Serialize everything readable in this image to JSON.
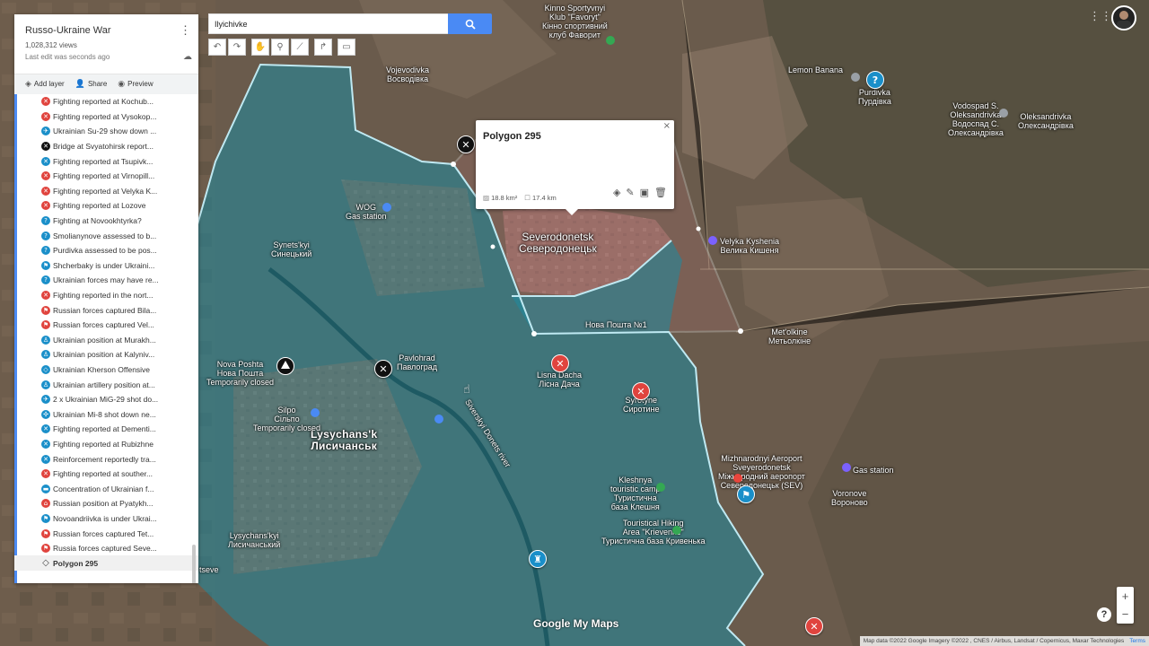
{
  "map": {
    "title": "Russo-Ukraine War",
    "views": "1,028,312 views",
    "last_edit": "Last edit was seconds ago",
    "actions": {
      "add_layer": "Add layer",
      "share": "Share",
      "preview": "Preview"
    },
    "search_value": "Ilyichivke",
    "colors": {
      "occupied": "#1e8aa0",
      "accent": "#4a8af4",
      "red_marker": "#e0443e"
    }
  },
  "layer_items": [
    {
      "label": "Fighting reported at Kochub...",
      "icon": "red-crossed-swords-icon",
      "color": "#e0443e"
    },
    {
      "label": "Fighting reported at Vysokop...",
      "icon": "red-crossed-swords-icon",
      "color": "#e0443e"
    },
    {
      "label": "Ukrainian Su-29 show down ...",
      "icon": "blue-plane-icon",
      "color": "#1a8fc9"
    },
    {
      "label": "Bridge at Svyatohirsk report...",
      "icon": "black-x-icon",
      "color": "#111111"
    },
    {
      "label": "Fighting reported at Tsupivk...",
      "icon": "blue-crossed-swords-icon",
      "color": "#1a8fc9"
    },
    {
      "label": "Fighting reported at Virnopill...",
      "icon": "red-crossed-swords-icon",
      "color": "#e0443e"
    },
    {
      "label": "Fighting reported at Velyka K...",
      "icon": "red-crossed-swords-icon",
      "color": "#e0443e"
    },
    {
      "label": "Fighting reported at Lozove",
      "icon": "red-crossed-swords-icon",
      "color": "#e0443e"
    },
    {
      "label": "Fighting at Novookhtyrka?",
      "icon": "blue-question-icon",
      "color": "#1a8fc9"
    },
    {
      "label": "Smolianynove assessed to b...",
      "icon": "blue-question-icon",
      "color": "#1a8fc9"
    },
    {
      "label": "Purdivka assessed to be pos...",
      "icon": "blue-question-icon",
      "color": "#1a8fc9"
    },
    {
      "label": "Shcherbaky is under Ukraini...",
      "icon": "blue-flag-icon",
      "color": "#1a8fc9"
    },
    {
      "label": "Ukrainian forces may have re...",
      "icon": "blue-question-icon",
      "color": "#1a8fc9"
    },
    {
      "label": "Fighting reported in the nort...",
      "icon": "red-crossed-swords-icon",
      "color": "#e0443e"
    },
    {
      "label": "Russian forces captured Bila...",
      "icon": "red-flag-icon",
      "color": "#e0443e"
    },
    {
      "label": "Russian forces captured Vel...",
      "icon": "red-flag-icon",
      "color": "#e0443e"
    },
    {
      "label": "Ukrainian position at Murakh...",
      "icon": "blue-soldier-icon",
      "color": "#1a8fc9"
    },
    {
      "label": "Ukrainian position at Kalyniv...",
      "icon": "blue-soldier-icon",
      "color": "#1a8fc9"
    },
    {
      "label": "Ukrainian Kherson Offensive",
      "icon": "blue-polygon-icon",
      "color": "#1a8fc9"
    },
    {
      "label": "Ukrainian artillery position at...",
      "icon": "blue-soldier-icon",
      "color": "#1a8fc9"
    },
    {
      "label": "2 x Ukrainian MiG-29 shot do...",
      "icon": "blue-plane-icon",
      "color": "#1a8fc9"
    },
    {
      "label": "Ukrainian Mi-8 shot down ne...",
      "icon": "blue-helicopter-icon",
      "color": "#1a8fc9"
    },
    {
      "label": "Fighting reported at Dementi...",
      "icon": "blue-crossed-swords-icon",
      "color": "#1a8fc9"
    },
    {
      "label": "Fighting reported at Rubizhne",
      "icon": "blue-crossed-swords-icon",
      "color": "#1a8fc9"
    },
    {
      "label": "Reinforcement reportedly tra...",
      "icon": "blue-crossed-swords-icon",
      "color": "#1a8fc9"
    },
    {
      "label": "Fighting reported at souther...",
      "icon": "red-crossed-swords-icon",
      "color": "#e0443e"
    },
    {
      "label": "Concentration of Ukrainian f...",
      "icon": "blue-tank-icon",
      "color": "#1a8fc9"
    },
    {
      "label": "Russian position at Pyatykh...",
      "icon": "red-house-icon",
      "color": "#e0443e"
    },
    {
      "label": "Novoandriivka is under Ukrai...",
      "icon": "blue-flag-icon",
      "color": "#1a8fc9"
    },
    {
      "label": "Russian forces captured Tet...",
      "icon": "red-flag-icon",
      "color": "#e0443e"
    },
    {
      "label": "Russia forces captured Seve...",
      "icon": "red-flag-icon",
      "color": "#e0443e"
    },
    {
      "label": "Polygon 295",
      "icon": "polygon-icon",
      "color": "#444444",
      "selected": true
    }
  ],
  "popup": {
    "title": "Polygon 295",
    "area": "18.8 km²",
    "perimeter": "17.4 km"
  },
  "map_labels": {
    "severodonetsk_en": "Severodonetsk",
    "severodonetsk_uk": "Северодонецьк",
    "lysychansk_en": "Lysychans'k",
    "lysychansk_uk": "Лисичанськ",
    "synetskyi_en": "Synets'kyi",
    "synetskyi_uk": "Синецький",
    "pavlohrad_en": "Pavlohrad",
    "pavlohrad_uk": "Павлоград",
    "vojevodivka_en": "Vojevodivka",
    "vojevodivka_uk": "Восводівка",
    "lemon_banana": "Lemon Banana",
    "purdivka_en": "Purdivka",
    "purdivka_uk": "Пурдівка",
    "vodospad_en": "Vodospad S.",
    "vodospad_en2": "Oleksandrivka",
    "vodospad_uk": "Водоспад С.",
    "vodospad_uk2": "Олександрівка",
    "oleksandrivka_en": "Oleksandrivka",
    "oleksandrivka_uk": "Олександрівка",
    "velyka_kyshenia_en": "Velyka Kyshenia",
    "velyka_kyshenia_uk": "Велика Кишеня",
    "metolkine_en": "Met'olkine",
    "metolkine_uk": "Метьолкіне",
    "lisna_dacha_en": "Lisna Dacha",
    "lisna_dacha_uk": "Лісна Дача",
    "syrotyne_en": "Syrotyne",
    "syrotyne_uk": "Сиротине",
    "nova_poshta_en": "Nova Poshta",
    "nova_poshta_uk": "Нова Пошта",
    "temp_closed": "Temporarily closed",
    "silpo_en": "Silpo",
    "silpo_uk": "Сільпо",
    "wog": "WOG",
    "gas_station": "Gas station",
    "airport_en": "Mizhnarodnyi Aeroport",
    "airport_en2": "Sveyerodonetsk",
    "airport_uk": "Міжнародний аеропорт",
    "airport_uk2": "Северодонецьк (SEV)",
    "voronove_en": "Voronove",
    "voronove_uk": "Вороново",
    "kleshnya_en": "Kleshnya",
    "kleshnya_en2": "touristic camp",
    "kleshnya_uk": "Туристична",
    "kleshnya_uk2": "база Клешня",
    "hiking_en": "Touristical Hiking",
    "hiking_en2": "Area \"Krievenke\"",
    "hiking_uk": "Туристична база Кривенька",
    "kinno_en": "Kinno Sportyvnyi",
    "kinno_en2": "Klub \"Favoryt\"",
    "kinno_uk": "Кінно спортивний",
    "kinno_uk2": "клуб Фаворит",
    "nova_n1": "Нова Пошта №1",
    "lysychansk_sm_en": "Lysychans'kyi",
    "lysychansk_sm_uk": "Лисичанський",
    "river": "Siverskyi Donets river",
    "gas_station2": "Gas station",
    "tseve": "tseve"
  },
  "bottom": {
    "logo": "Google My Maps",
    "attribution": "Map data ©2022 Google Imagery ©2022 , CNES / Airbus, Landsat / Copernicus, Maxar Technologies",
    "terms": "Terms"
  }
}
